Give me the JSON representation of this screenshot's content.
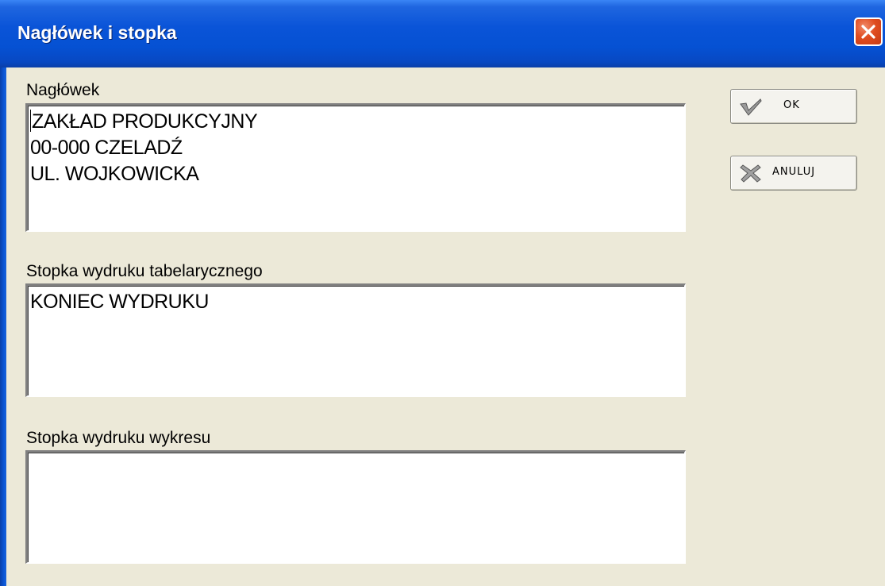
{
  "window": {
    "title": "Nagłówek i stopka",
    "close_icon": "close-icon"
  },
  "header_section": {
    "label": "Nagłówek",
    "lines": [
      "ZAKŁAD PRODUKCYJNY",
      "00-000 CZELADŹ",
      "UL. WOJKOWICKA"
    ]
  },
  "table_footer_section": {
    "label": "Stopka wydruku tabelarycznego",
    "lines": [
      "KONIEC WYDRUKU"
    ]
  },
  "chart_footer_section": {
    "label": "Stopka wydruku wykresu",
    "lines": []
  },
  "buttons": {
    "ok_label": "OK",
    "ok_icon": "checkmark-icon",
    "cancel_label": "ANULUJ",
    "cancel_icon": "x-mark-icon"
  },
  "colors": {
    "titlebar": "#0a54d8",
    "dialog_bg": "#ece9d8",
    "close_button": "#e04d20"
  }
}
